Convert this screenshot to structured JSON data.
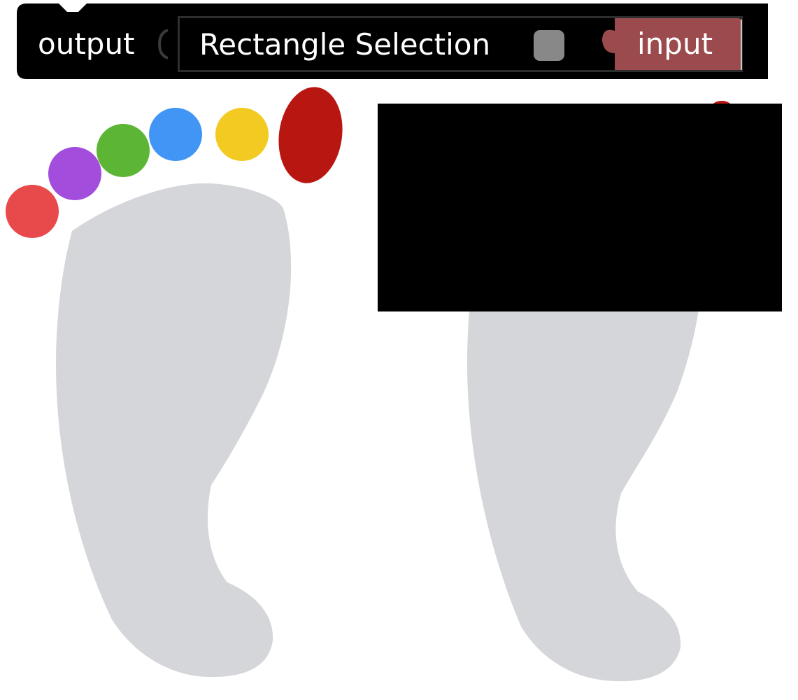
{
  "block": {
    "output_label": "output",
    "field_label": "Rectangle Selection",
    "input_label": "input"
  },
  "colors": {
    "block_bg": "#000000",
    "field_border": "#2e2e2e",
    "toggle": "#888888",
    "input_block": "#9b4a4d",
    "foot": "#d5d6da",
    "toe_red": "#e84a4c",
    "toe_purple": "#a24ddc",
    "toe_green": "#5db535",
    "toe_blue": "#4195f5",
    "toe_yellow": "#f3ca22",
    "toe_big": "#b81611",
    "selection_rect": "#000000"
  }
}
